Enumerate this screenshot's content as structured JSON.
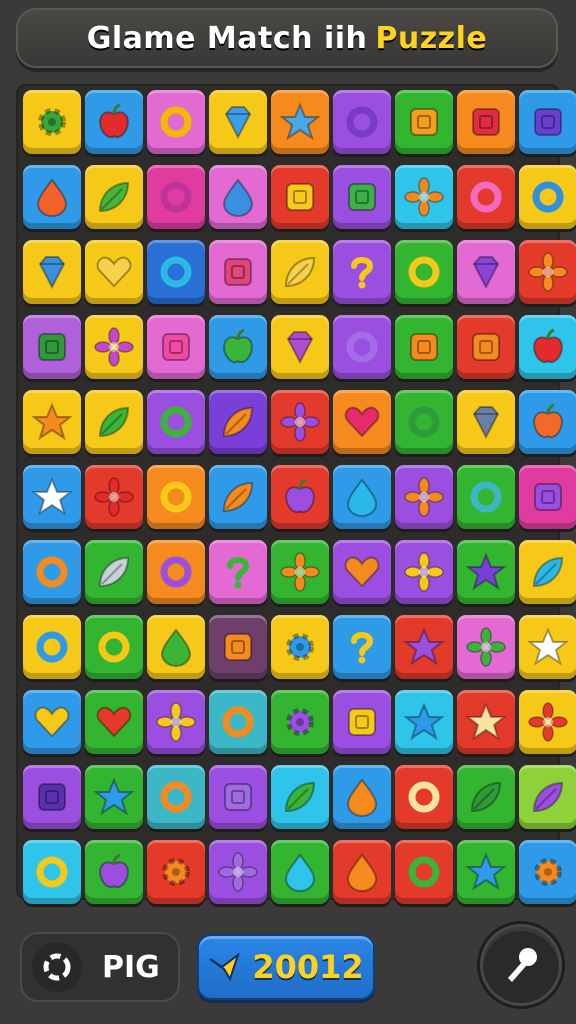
{
  "header": {
    "title_main": "Glame Match iih",
    "title_accent": "Puzzle"
  },
  "colors": {
    "yellow": "#f6c818",
    "blue": "#2f9ae8",
    "pink": "#e26ad2",
    "orange": "#f58a1f",
    "purple": "#9a4fe0",
    "green": "#33b531",
    "red": "#e33a2c",
    "teal": "#3cb7c8",
    "lime": "#8fd13a",
    "magenta": "#e03ca0",
    "cyan": "#2fc4ea",
    "violet": "#7a3fd8",
    "darkblue": "#2a6fd6",
    "mauve": "#b060d8",
    "plum": "#6e3f6a"
  },
  "board": {
    "rows": [
      [
        {
          "c": "yellow",
          "i": "gear",
          "ic": "#3aa53a"
        },
        {
          "c": "blue",
          "i": "apple",
          "ic": "#e42b2b"
        },
        {
          "c": "pink",
          "i": "ring",
          "ic": "#f5b800"
        },
        {
          "c": "yellow",
          "i": "gem",
          "ic": "#3a9fe8"
        },
        {
          "c": "orange",
          "i": "star",
          "ic": "#48a8e8"
        },
        {
          "c": "purple",
          "i": "ring",
          "ic": "#7a3bc2"
        },
        {
          "c": "green",
          "i": "square",
          "ic": "#f59d1e"
        },
        {
          "c": "orange",
          "i": "square",
          "ic": "#e22b45"
        },
        {
          "c": "blue",
          "i": "square",
          "ic": "#6a3fd0"
        }
      ],
      [
        {
          "c": "blue",
          "i": "drop",
          "ic": "#f2622a"
        },
        {
          "c": "yellow",
          "i": "leaf",
          "ic": "#44b63c"
        },
        {
          "c": "magenta",
          "i": "ring",
          "ic": "#c0349a"
        },
        {
          "c": "pink",
          "i": "drop",
          "ic": "#3a8fe0"
        },
        {
          "c": "red",
          "i": "square",
          "ic": "#f7c71a"
        },
        {
          "c": "purple",
          "i": "square",
          "ic": "#3eb04a"
        },
        {
          "c": "cyan",
          "i": "flower",
          "ic": "#f08a1e"
        },
        {
          "c": "red",
          "i": "ring",
          "ic": "#f26bc0"
        },
        {
          "c": "yellow",
          "i": "ring",
          "ic": "#2f8fe0"
        }
      ],
      [
        {
          "c": "yellow",
          "i": "gem",
          "ic": "#3a8fe0"
        },
        {
          "c": "yellow",
          "i": "heart",
          "ic": "#f8d14a"
        },
        {
          "c": "darkblue",
          "i": "ring",
          "ic": "#2bb8e8"
        },
        {
          "c": "pink",
          "i": "square",
          "ic": "#e2447e"
        },
        {
          "c": "yellow",
          "i": "leaf",
          "ic": "#f8d14a"
        },
        {
          "c": "purple",
          "i": "question",
          "ic": "#f6c818"
        },
        {
          "c": "green",
          "i": "ring",
          "ic": "#f6c818"
        },
        {
          "c": "pink",
          "i": "gem",
          "ic": "#8a44d8"
        },
        {
          "c": "red",
          "i": "flower",
          "ic": "#f58a1f"
        }
      ],
      [
        {
          "c": "mauve",
          "i": "square",
          "ic": "#2f9a3a"
        },
        {
          "c": "yellow",
          "i": "flower",
          "ic": "#c548c8"
        },
        {
          "c": "pink",
          "i": "square",
          "ic": "#f04aa2"
        },
        {
          "c": "blue",
          "i": "apple",
          "ic": "#3ab53a"
        },
        {
          "c": "yellow",
          "i": "gem",
          "ic": "#b04ad0"
        },
        {
          "c": "purple",
          "i": "ring",
          "ic": "#a66ce8"
        },
        {
          "c": "green",
          "i": "square",
          "ic": "#f58a1f"
        },
        {
          "c": "red",
          "i": "square",
          "ic": "#f58a1f"
        },
        {
          "c": "cyan",
          "i": "apple",
          "ic": "#e42b2b"
        }
      ],
      [
        {
          "c": "yellow",
          "i": "star",
          "ic": "#f58a1f"
        },
        {
          "c": "yellow",
          "i": "leaf",
          "ic": "#3ab53a"
        },
        {
          "c": "purple",
          "i": "ring",
          "ic": "#3ab53a"
        },
        {
          "c": "violet",
          "i": "leaf",
          "ic": "#f58a1f"
        },
        {
          "c": "red",
          "i": "flower",
          "ic": "#9a4fe0"
        },
        {
          "c": "orange",
          "i": "heart",
          "ic": "#e62b6a"
        },
        {
          "c": "green",
          "i": "ring",
          "ic": "#2f9a3a"
        },
        {
          "c": "yellow",
          "i": "gem",
          "ic": "#6a7fa8"
        },
        {
          "c": "blue",
          "i": "apple",
          "ic": "#f26a2a"
        }
      ],
      [
        {
          "c": "blue",
          "i": "star",
          "ic": "#ffffff"
        },
        {
          "c": "red",
          "i": "flower",
          "ic": "#e02b2b"
        },
        {
          "c": "orange",
          "i": "ring",
          "ic": "#f6c818"
        },
        {
          "c": "blue",
          "i": "leaf",
          "ic": "#f58a1f"
        },
        {
          "c": "red",
          "i": "apple",
          "ic": "#9a4fe0"
        },
        {
          "c": "blue",
          "i": "drop",
          "ic": "#2bb8e8"
        },
        {
          "c": "purple",
          "i": "flower",
          "ic": "#f58a1f"
        },
        {
          "c": "green",
          "i": "ring",
          "ic": "#3cb7c8"
        },
        {
          "c": "magenta",
          "i": "square",
          "ic": "#9a4fe0"
        }
      ],
      [
        {
          "c": "blue",
          "i": "ring",
          "ic": "#f58a1f"
        },
        {
          "c": "green",
          "i": "leaf",
          "ic": "#c8d0d8"
        },
        {
          "c": "orange",
          "i": "ring",
          "ic": "#9a4fe0"
        },
        {
          "c": "pink",
          "i": "question",
          "ic": "#3ab53a"
        },
        {
          "c": "green",
          "i": "flower",
          "ic": "#f58a1f"
        },
        {
          "c": "purple",
          "i": "heart",
          "ic": "#f58a1f"
        },
        {
          "c": "purple",
          "i": "flower",
          "ic": "#f6c818"
        },
        {
          "c": "green",
          "i": "star",
          "ic": "#7a3fd8"
        },
        {
          "c": "yellow",
          "i": "leaf",
          "ic": "#2bb8e8"
        }
      ],
      [
        {
          "c": "yellow",
          "i": "ring",
          "ic": "#2f9ae8"
        },
        {
          "c": "green",
          "i": "ring",
          "ic": "#f6c818"
        },
        {
          "c": "yellow",
          "i": "drop",
          "ic": "#3ab53a"
        },
        {
          "c": "plum",
          "i": "square",
          "ic": "#f58a1f"
        },
        {
          "c": "yellow",
          "i": "gear",
          "ic": "#2f9ae8"
        },
        {
          "c": "blue",
          "i": "question",
          "ic": "#f6c818"
        },
        {
          "c": "red",
          "i": "star",
          "ic": "#9a4fe0"
        },
        {
          "c": "pink",
          "i": "flower",
          "ic": "#3ab53a"
        },
        {
          "c": "yellow",
          "i": "star",
          "ic": "#ffffff"
        }
      ],
      [
        {
          "c": "blue",
          "i": "heart",
          "ic": "#f6c818"
        },
        {
          "c": "green",
          "i": "heart",
          "ic": "#e33a2c"
        },
        {
          "c": "purple",
          "i": "flower",
          "ic": "#f6c818"
        },
        {
          "c": "teal",
          "i": "ring",
          "ic": "#f58a1f"
        },
        {
          "c": "green",
          "i": "gear",
          "ic": "#9a4fe0"
        },
        {
          "c": "purple",
          "i": "square",
          "ic": "#f6c818"
        },
        {
          "c": "cyan",
          "i": "star",
          "ic": "#2f9ae8"
        },
        {
          "c": "red",
          "i": "star",
          "ic": "#f8e4a0"
        },
        {
          "c": "yellow",
          "i": "flower",
          "ic": "#e33a2c"
        }
      ],
      [
        {
          "c": "purple",
          "i": "square",
          "ic": "#5a2fb0"
        },
        {
          "c": "green",
          "i": "star",
          "ic": "#2f9ae8"
        },
        {
          "c": "teal",
          "i": "ring",
          "ic": "#f58a1f"
        },
        {
          "c": "purple",
          "i": "square",
          "ic": "#a06ae0"
        },
        {
          "c": "cyan",
          "i": "leaf",
          "ic": "#3ab53a"
        },
        {
          "c": "blue",
          "i": "drop",
          "ic": "#f58a1f"
        },
        {
          "c": "red",
          "i": "ring",
          "ic": "#f8e4a0"
        },
        {
          "c": "green",
          "i": "leaf",
          "ic": "#2f9a3a"
        },
        {
          "c": "lime",
          "i": "leaf",
          "ic": "#9a4fe0"
        }
      ],
      [
        {
          "c": "cyan",
          "i": "ring",
          "ic": "#f6c818"
        },
        {
          "c": "green",
          "i": "apple",
          "ic": "#9a4fe0"
        },
        {
          "c": "red",
          "i": "gear",
          "ic": "#f58a1f"
        },
        {
          "c": "purple",
          "i": "flower",
          "ic": "#a06ae0"
        },
        {
          "c": "green",
          "i": "drop",
          "ic": "#2fc4ea"
        },
        {
          "c": "red",
          "i": "drop",
          "ic": "#f58a1f"
        },
        {
          "c": "red",
          "i": "ring",
          "ic": "#3ab53a"
        },
        {
          "c": "green",
          "i": "star",
          "ic": "#2f9ae8"
        },
        {
          "c": "blue",
          "i": "gear",
          "ic": "#f58a1f"
        }
      ]
    ]
  },
  "bottom": {
    "left_label": "PIG",
    "score": "20012"
  }
}
